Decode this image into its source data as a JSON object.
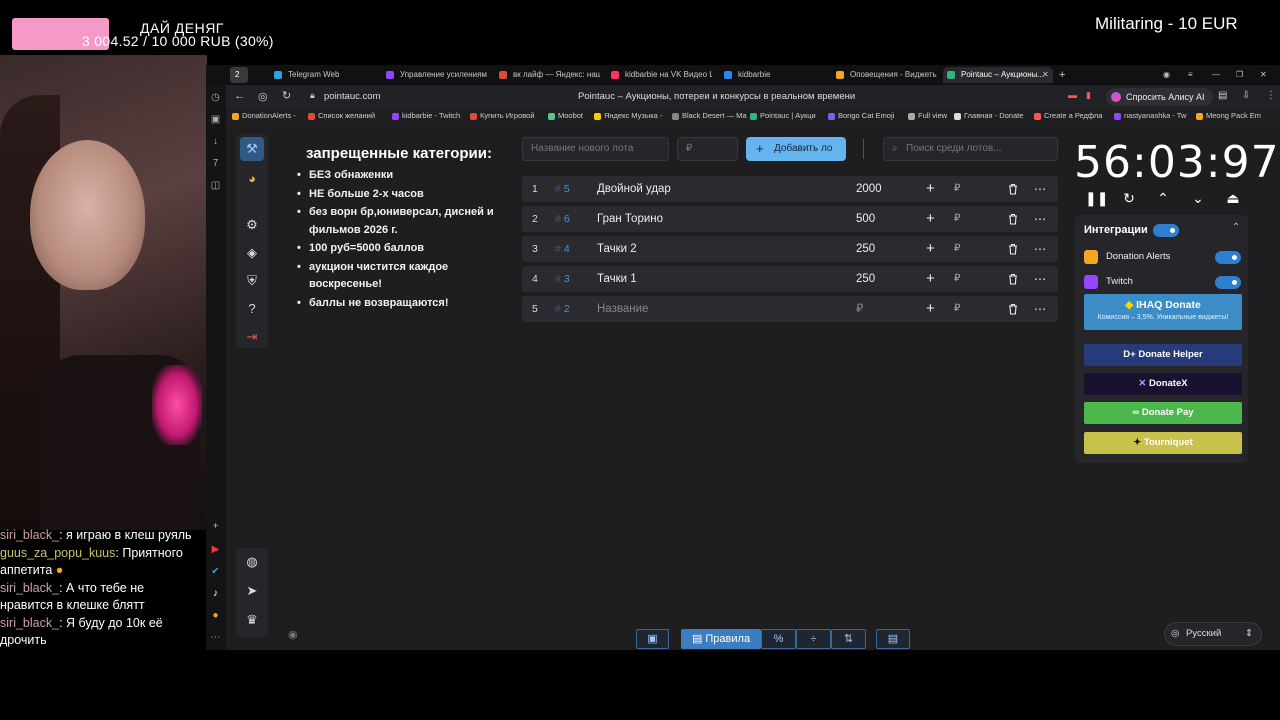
{
  "overlay": {
    "donation_title": "ДАЙ ДЕНЯГ",
    "donation_amount": "3 004.52 / 10 000 RUB (30%)",
    "donation_progress": 0.3,
    "militaring": "Militaring - 10 EUR",
    "chat": [
      {
        "user": "siri_black_",
        "text": "я играю в клеш руяль"
      },
      {
        "user": "guus_za_popu_kuus",
        "text": "Приятного"
      },
      {
        "user": "",
        "text": "аппетита"
      },
      {
        "user": "siri_black_",
        "text": "А что тебе не"
      },
      {
        "user": "",
        "text": "нравится в клешке блятт"
      },
      {
        "user": "siri_black_",
        "text": "Я буду до 10к её"
      },
      {
        "user": "",
        "text": "дрочить"
      }
    ]
  },
  "browser": {
    "tabs": [
      {
        "label": "Telegram Web",
        "color": "#2aa3e0"
      },
      {
        "label": "Управление усилениями",
        "color": "#9146ff"
      },
      {
        "label": "вк лайф — Яндекс: нашёл",
        "color": "#e04a3a"
      },
      {
        "label": "kidbarbie на VK Видео Live",
        "color": "#ff3366"
      },
      {
        "label": "kidbarbie",
        "color": "#2787f5"
      },
      {
        "label": "Оповещения - Виджеты",
        "color": "#f5a623"
      },
      {
        "label": "Pointauc – Аукционы...",
        "color": "#2fb67a"
      }
    ],
    "url": "pointauc.com",
    "page_title": "Pointauc – Аукционы, потереи и конкурсы в реальном времени",
    "alice_label": "Спросить Алису AI",
    "bookmarks": [
      "DonationAlerts -",
      "Список желаний",
      "kidbarbie - Twitch",
      "Купить Игровой",
      "Moobot",
      "Яндекс Музыка -",
      "Black Desert — Ма",
      "Pointauc | Аукци",
      "Bongo Cat Emoji",
      "Full view",
      "Главная - Donate",
      "Create a Редфла",
      "nastyanashka - Tw",
      "Meong Pack Em"
    ]
  },
  "app": {
    "rules_title": "запрещенные категории:",
    "rules": [
      "БЕЗ обнаженки",
      "НЕ больше 2-х часов",
      "без ворн бр,юниверсал, дисней и фильмов 2026 г.",
      "100 руб=5000 баллов",
      "аукцион чистится каждое воскресенье!",
      "баллы не возвращаются!"
    ],
    "new_lot_placeholder": "Название нового лота",
    "amount_placeholder": "₽",
    "add_button": "Добавить ло",
    "search_placeholder": "Поиск среди лотов...",
    "currency": "₽",
    "lots": [
      {
        "num": "1",
        "id": "5",
        "name": "Двойной удар",
        "amount": "2000"
      },
      {
        "num": "2",
        "id": "6",
        "name": "Гран Торино",
        "amount": "500"
      },
      {
        "num": "3",
        "id": "4",
        "name": "Тачки 2",
        "amount": "250"
      },
      {
        "num": "4",
        "id": "3",
        "name": "Тачки 1",
        "amount": "250"
      },
      {
        "num": "5",
        "id": "2",
        "name": "Название",
        "amount": "₽"
      }
    ],
    "timer": "56:03:97",
    "integrations_title": "Интеграции",
    "integrations": [
      {
        "label": "Donation Alerts",
        "color": "#f5a623"
      },
      {
        "label": "Twitch",
        "color": "#9146ff"
      }
    ],
    "ihaq": {
      "label": "IHAQ Donate",
      "sub": "Комиссия – 3,5%. Уникальные виджеты!"
    },
    "donate_buttons": [
      {
        "label": "Donate Helper",
        "color": "#273a7a"
      },
      {
        "label": "DonateX",
        "color": "#1a1030"
      },
      {
        "label": "Donate Pay",
        "color": "#4cb84c"
      },
      {
        "label": "Tourniquet",
        "color": "#c8c24a"
      }
    ],
    "footer_rules_label": "Правила",
    "language": "Русский"
  }
}
